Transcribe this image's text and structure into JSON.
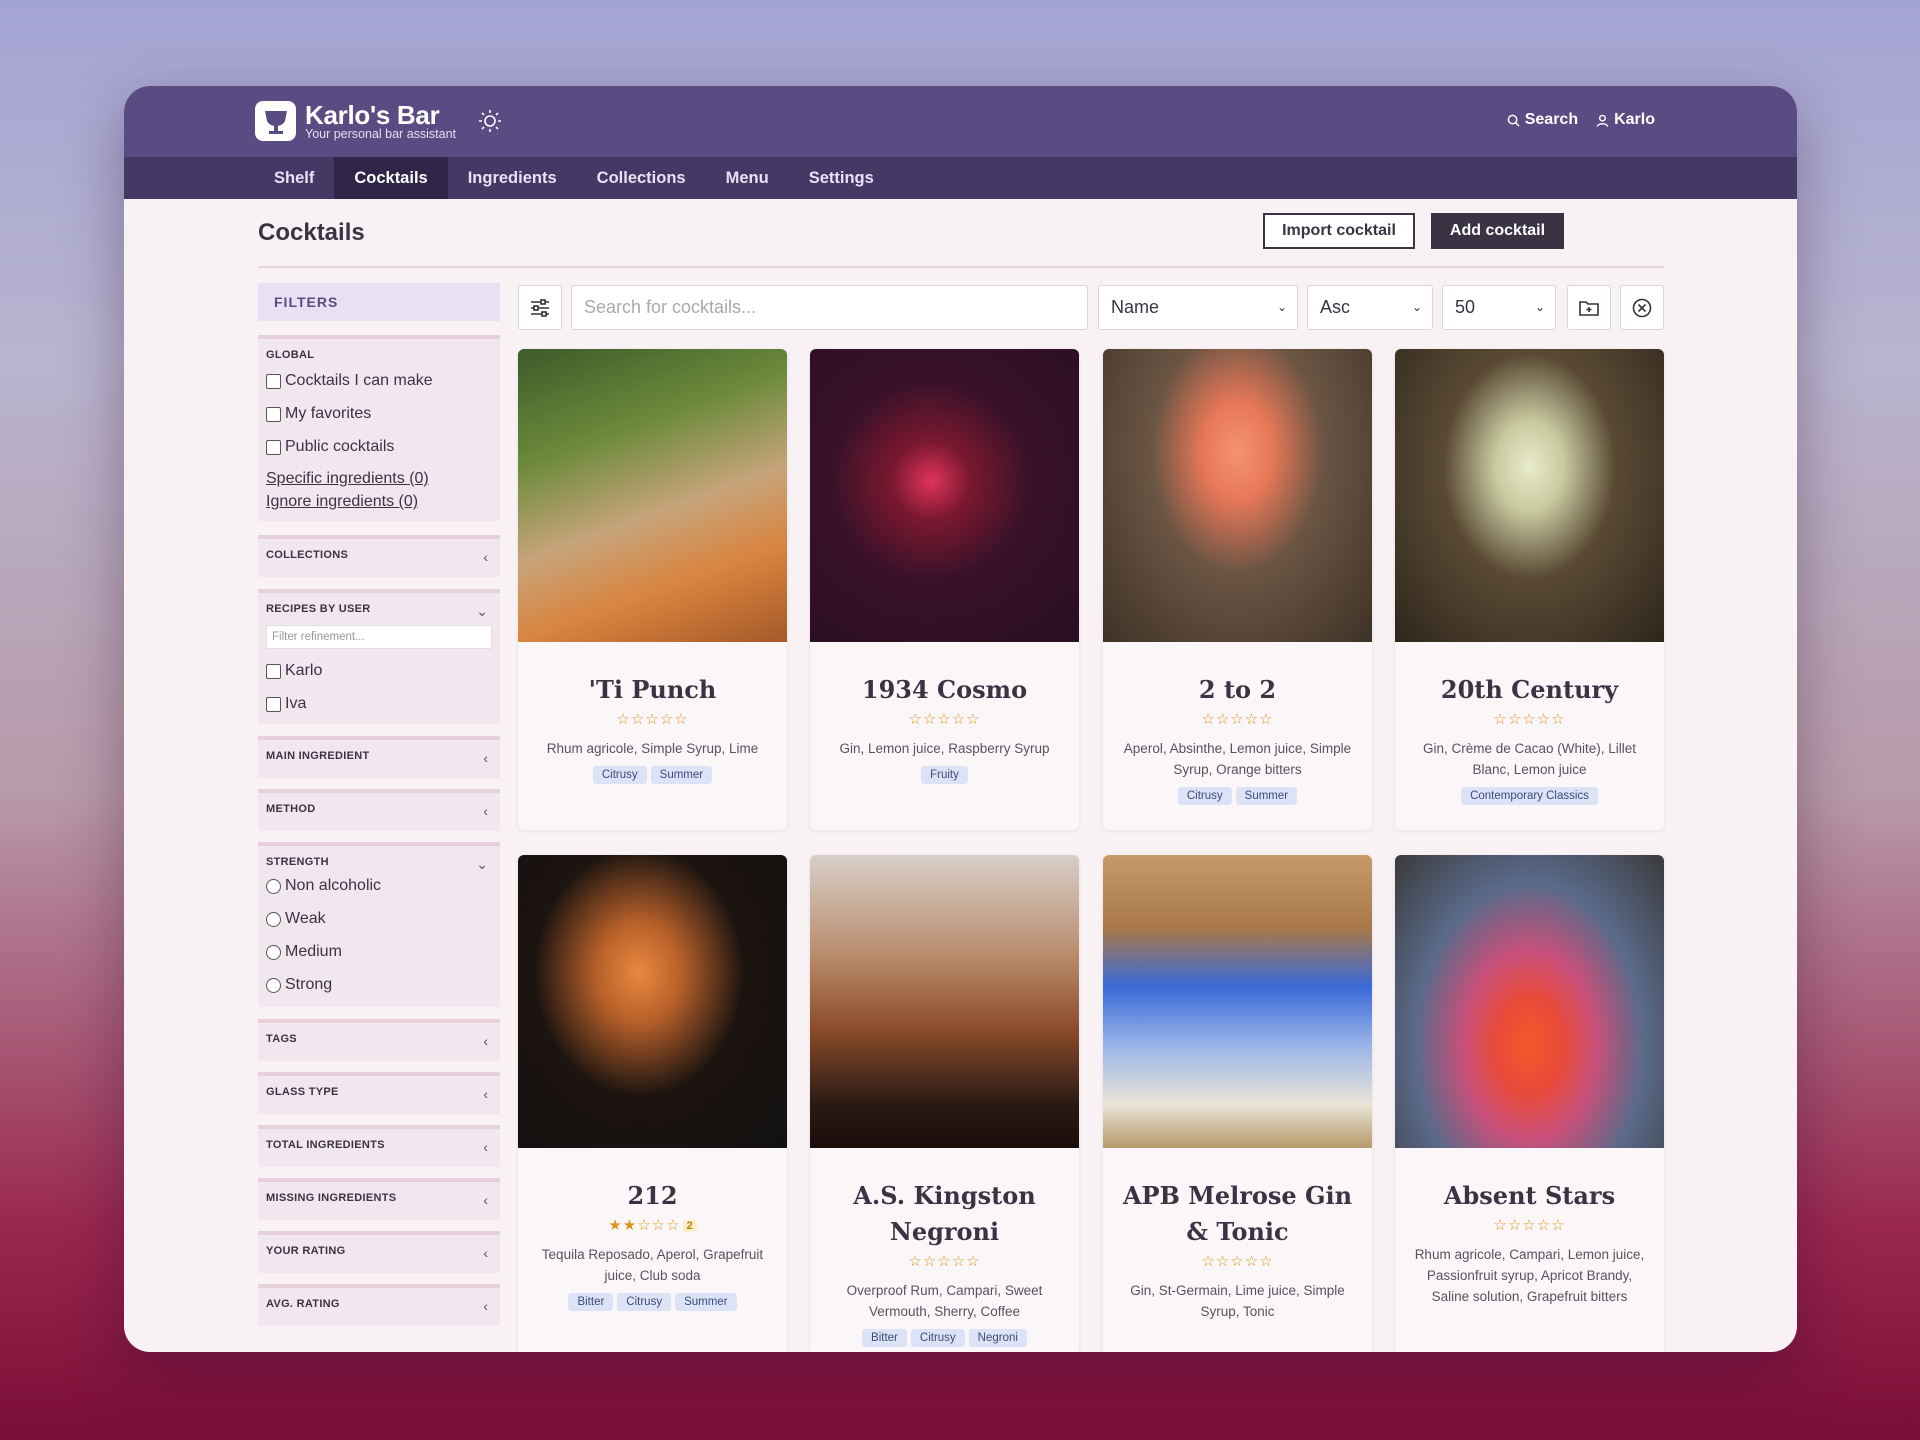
{
  "brand": {
    "title": "Karlo's Bar",
    "subtitle": "Your personal bar assistant"
  },
  "top_actions": {
    "search": "Search",
    "user": "Karlo"
  },
  "nav": {
    "tabs": [
      "Shelf",
      "Cocktails",
      "Ingredients",
      "Collections",
      "Menu",
      "Settings"
    ],
    "active": "Cocktails"
  },
  "page": {
    "title": "Cocktails",
    "import_label": "Import cocktail",
    "add_label": "Add cocktail"
  },
  "filters": {
    "heading": "FILTERS",
    "global": {
      "title": "GLOBAL",
      "options": [
        "Cocktails I can make",
        "My favorites",
        "Public cocktails"
      ],
      "links": [
        "Specific ingredients (0)",
        "Ignore ingredients (0)"
      ]
    },
    "collections": "COLLECTIONS",
    "recipes_by_user": {
      "title": "RECIPES BY USER",
      "placeholder": "Filter refinement...",
      "users": [
        "Karlo",
        "Iva"
      ]
    },
    "main_ingredient": "MAIN INGREDIENT",
    "method": "METHOD",
    "strength": {
      "title": "STRENGTH",
      "options": [
        "Non alcoholic",
        "Weak",
        "Medium",
        "Strong"
      ]
    },
    "tags": "TAGS",
    "glass_type": "GLASS TYPE",
    "total_ingredients": "TOTAL INGREDIENTS",
    "missing_ingredients": "MISSING INGREDIENTS",
    "your_rating": "YOUR RATING",
    "avg_rating": "AVG. RATING"
  },
  "toolbar": {
    "search_placeholder": "Search for cocktails...",
    "sort_field": "Name",
    "sort_dir": "Asc",
    "per_page": "50"
  },
  "cocktails": [
    {
      "name": "'Ti Punch",
      "stars": "☆☆☆☆☆",
      "rating_count": "",
      "ingredients": "Rhum agricole, Simple Syrup, Lime",
      "tags": [
        "Citrusy",
        "Summer"
      ]
    },
    {
      "name": "1934 Cosmo",
      "stars": "☆☆☆☆☆",
      "rating_count": "",
      "ingredients": "Gin, Lemon juice, Raspberry Syrup",
      "tags": [
        "Fruity"
      ]
    },
    {
      "name": "2 to 2",
      "stars": "☆☆☆☆☆",
      "rating_count": "",
      "ingredients": "Aperol, Absinthe, Lemon juice, Simple Syrup, Orange bitters",
      "tags": [
        "Citrusy",
        "Summer"
      ]
    },
    {
      "name": "20th Century",
      "stars": "☆☆☆☆☆",
      "rating_count": "",
      "ingredients": "Gin, Crème de Cacao (White), Lillet Blanc, Lemon juice",
      "tags": [
        "Contemporary Classics"
      ]
    },
    {
      "name": "212",
      "stars": "★★☆☆☆",
      "rating_count": "2",
      "ingredients": "Tequila Reposado, Aperol, Grapefruit juice, Club soda",
      "tags": [
        "Bitter",
        "Citrusy",
        "Summer"
      ]
    },
    {
      "name": "A.S. Kingston Negroni",
      "stars": "☆☆☆☆☆",
      "rating_count": "",
      "ingredients": "Overproof Rum, Campari, Sweet Vermouth, Sherry, Coffee",
      "tags": [
        "Bitter",
        "Citrusy",
        "Negroni"
      ]
    },
    {
      "name": "APB Melrose Gin & Tonic",
      "stars": "☆☆☆☆☆",
      "rating_count": "",
      "ingredients": "Gin, St-Germain, Lime juice, Simple Syrup, Tonic",
      "tags": []
    },
    {
      "name": "Absent Stars",
      "stars": "☆☆☆☆☆",
      "rating_count": "",
      "ingredients": "Rhum agricole, Campari, Lemon juice, Passionfruit syrup, Apricot Brandy, Saline solution, Grapefruit bitters",
      "tags": []
    }
  ],
  "colors": {
    "header": "#5a4b83",
    "nav": "#443865",
    "accent_star": "#e0941c"
  }
}
